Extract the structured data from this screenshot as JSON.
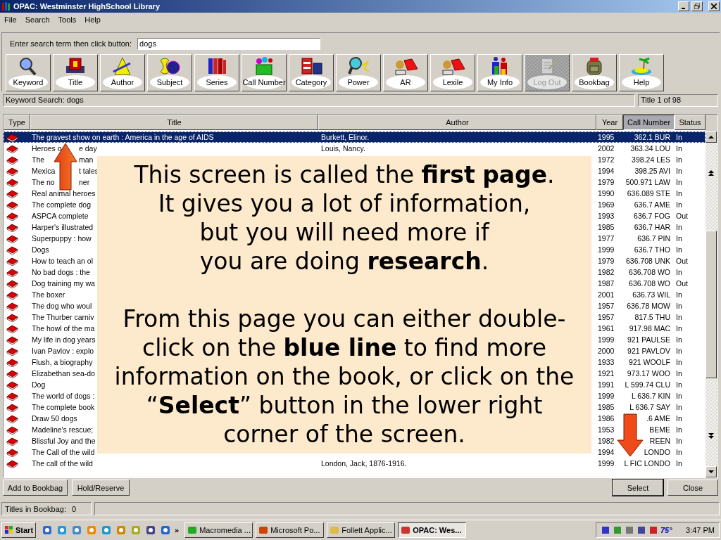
{
  "window": {
    "title": "OPAC: Westminster HighSchool Library"
  },
  "menu": [
    "File",
    "Search",
    "Tools",
    "Help"
  ],
  "search": {
    "label": "Enter search term then click button:",
    "value": "dogs"
  },
  "toolbar": [
    {
      "label": "Keyword",
      "disabled": false
    },
    {
      "label": "Title",
      "disabled": false
    },
    {
      "label": "Author",
      "disabled": false
    },
    {
      "label": "Subject",
      "disabled": false
    },
    {
      "label": "Series",
      "disabled": false
    },
    {
      "label": "Call Number",
      "disabled": false
    },
    {
      "label": "Category",
      "disabled": false
    },
    {
      "label": "Power",
      "disabled": false
    },
    {
      "label": "AR",
      "disabled": false
    },
    {
      "label": "Lexile",
      "disabled": false
    },
    {
      "label": "My Info",
      "disabled": false
    },
    {
      "label": "Log Out",
      "disabled": true
    },
    {
      "label": "Bookbag",
      "disabled": false
    },
    {
      "label": "Help",
      "disabled": false
    }
  ],
  "search_status": "Keyword Search: dogs",
  "result_count": "Title 1 of 98",
  "table": {
    "columns": [
      {
        "label": "Type",
        "selected": false
      },
      {
        "label": "Title",
        "selected": false
      },
      {
        "label": "Author",
        "selected": false
      },
      {
        "label": "Year",
        "selected": false
      },
      {
        "label": "Call Number",
        "selected": true
      },
      {
        "label": "Status",
        "selected": false
      }
    ],
    "rows": [
      {
        "title": "The gravest show on earth : America in the age of AIDS",
        "author": "Burkett, Elinor.",
        "year": "1995",
        "call_number": "362.1 BUR",
        "status": "In",
        "selected": true
      },
      {
        "title": "Heroes o",
        "title_rest": "e day",
        "author": "Louis, Nancy.",
        "year": "2002",
        "call_number": "363.34 LOU",
        "status": "In",
        "selected": false
      },
      {
        "title": "The",
        "title_rest": "man",
        "year": "1972",
        "call_number": "398.24 LES",
        "status": "In",
        "selected": false
      },
      {
        "title": "Mexica",
        "title_rest": "t tales",
        "year": "1994",
        "call_number": "398.25 AVI",
        "status": "In",
        "selected": false
      },
      {
        "title": "The no",
        "title_rest": "ner",
        "year": "1979",
        "call_number": "500.971 LAW",
        "status": "In",
        "selected": false
      },
      {
        "title": "Real animal heroes",
        "year": "1990",
        "call_number": "636.089 STE",
        "status": "In",
        "selected": false
      },
      {
        "title": "The complete dog",
        "year": "1969",
        "call_number": "636.7 AME",
        "status": "In",
        "selected": false
      },
      {
        "title": "ASPCA complete",
        "year": "1993",
        "call_number": "636.7 FOG",
        "status": "Out",
        "selected": false
      },
      {
        "title": "Harper's illustrated",
        "year": "1985",
        "call_number": "636.7 HAR",
        "status": "In",
        "selected": false
      },
      {
        "title": "Superpuppy : how",
        "year": "1977",
        "call_number": "636.7 PIN",
        "status": "In",
        "selected": false
      },
      {
        "title": "Dogs",
        "year": "1999",
        "call_number": "636.7 THO",
        "status": "In",
        "selected": false
      },
      {
        "title": "How to teach an ol",
        "year": "1979",
        "call_number": "636.708 UNK",
        "status": "Out",
        "selected": false
      },
      {
        "title": "No bad dogs : the",
        "year": "1982",
        "call_number": "636.708 WO",
        "status": "In",
        "selected": false
      },
      {
        "title": "Dog training my wa",
        "year": "1987",
        "call_number": "636.708 WO",
        "status": "Out",
        "selected": false
      },
      {
        "title": "The boxer",
        "year": "2001",
        "call_number": "636.73 WIL",
        "status": "In",
        "selected": false
      },
      {
        "title": "The dog who woul",
        "year": "1957",
        "call_number": "636.78 MOW",
        "status": "In",
        "selected": false
      },
      {
        "title": "The Thurber carniv",
        "year": "1957",
        "call_number": "817.5 THU",
        "status": "In",
        "selected": false
      },
      {
        "title": "The howl of the ma",
        "year": "1961",
        "call_number": "917.98 MAC",
        "status": "In",
        "selected": false
      },
      {
        "title": "My life in dog years",
        "year": "1999",
        "call_number": "921 PAULSE",
        "status": "In",
        "selected": false
      },
      {
        "title": "Ivan Pavlov : explo",
        "year": "2000",
        "call_number": "921 PAVLOV",
        "status": "In",
        "selected": false
      },
      {
        "title": "Flush, a biography",
        "year": "1933",
        "call_number": "921 WOOLF",
        "status": "In",
        "selected": false
      },
      {
        "title": "Elizabethan sea-do",
        "year": "1921",
        "call_number": "973.17 WOO",
        "status": "In",
        "selected": false
      },
      {
        "title": "Dog",
        "year": "1991",
        "call_number": "L 599.74 CLU",
        "status": "In",
        "selected": false
      },
      {
        "title": "The world of dogs :",
        "year": "1999",
        "call_number": "L 636.7 KIN",
        "status": "In",
        "selected": false
      },
      {
        "title": "The complete book",
        "year": "1985",
        "call_number": "L 636.7 SAY",
        "status": "In",
        "selected": false
      },
      {
        "title": "Draw 50 dogs",
        "year": "1986",
        "call_number": ".6 AME",
        "status": "In",
        "selected": false
      },
      {
        "title": "Madeline's rescue;",
        "year": "1953",
        "call_number": "BEME",
        "status": "In",
        "selected": false
      },
      {
        "title": "Blissful Joy and the",
        "year": "1982",
        "call_number": "REEN",
        "status": "In",
        "selected": false
      },
      {
        "title": "The Call of the wild",
        "year": "1994",
        "call_number": "LONDO",
        "status": "In",
        "selected": false
      },
      {
        "title": "The call of the wild",
        "author": "London, Jack, 1876-1916.",
        "year": "1999",
        "call_number": "L FIC LONDO",
        "status": "In",
        "selected": false
      }
    ]
  },
  "callout": {
    "paragraphs": [
      [
        "This screen is called the **first** **page**.",
        "It gives you a lot of information,",
        "but you will need more if",
        "you are doing **research**."
      ],
      [
        "From this page you can either double-",
        "click on the **blue line** to find more",
        "information on the book, or click on the",
        "“**Select**” button in the lower right",
        "corner of the screen."
      ]
    ]
  },
  "buttons_left": [
    "Add to Bookbag",
    "Hold/Reserve"
  ],
  "buttons_right": [
    {
      "label": "Select",
      "default": true
    },
    {
      "label": "Close",
      "default": false
    }
  ],
  "status_bar": {
    "label": "Titles in Bookbag:",
    "value": "0"
  },
  "taskbar": {
    "start": "Start",
    "more": "»",
    "tasks": [
      {
        "label": "Macromedia ...",
        "selected": false
      },
      {
        "label": "Microsoft Po...",
        "selected": false
      },
      {
        "label": "Follett Applic...",
        "selected": false
      },
      {
        "label": "OPAC: Wes...",
        "selected": true
      }
    ],
    "temperature": "75°",
    "clock": "3:47 PM"
  }
}
